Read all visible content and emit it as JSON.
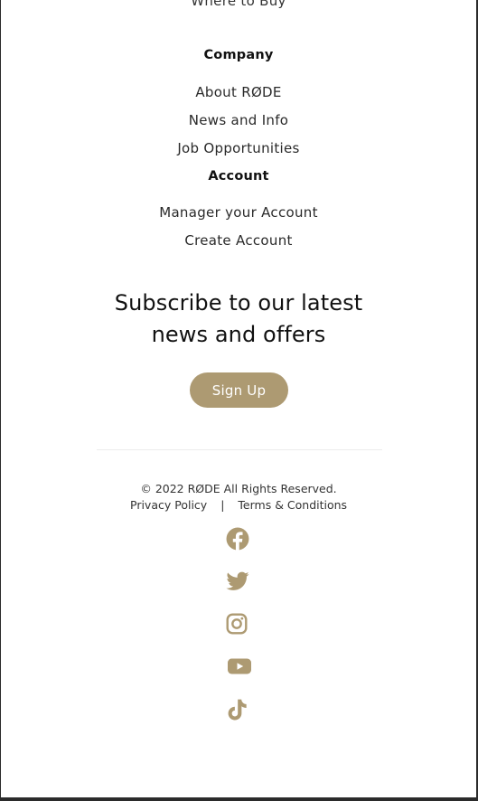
{
  "footer": {
    "partial_link": "Where to Buy",
    "company": {
      "heading": "Company",
      "links": [
        "About RØDE",
        "News and Info",
        "Job Opportunities"
      ]
    },
    "account": {
      "heading": "Account",
      "links": [
        "Manager your Account",
        "Create Account"
      ]
    },
    "subscribe": {
      "line1": "Subscribe to our latest",
      "line2": "news and offers",
      "button_label": "Sign Up"
    },
    "legal": {
      "copyright": "© 2022 RØDE All Rights Reserved.",
      "privacy": "Privacy Policy",
      "separator": "|",
      "terms": "Terms & Conditions"
    },
    "social_icons": [
      "facebook-icon",
      "twitter-icon",
      "instagram-icon",
      "youtube-icon",
      "tiktok-icon"
    ],
    "colors": {
      "accent": "#ad9a72",
      "text": "#1a1a1a",
      "background": "#ffffff"
    }
  }
}
